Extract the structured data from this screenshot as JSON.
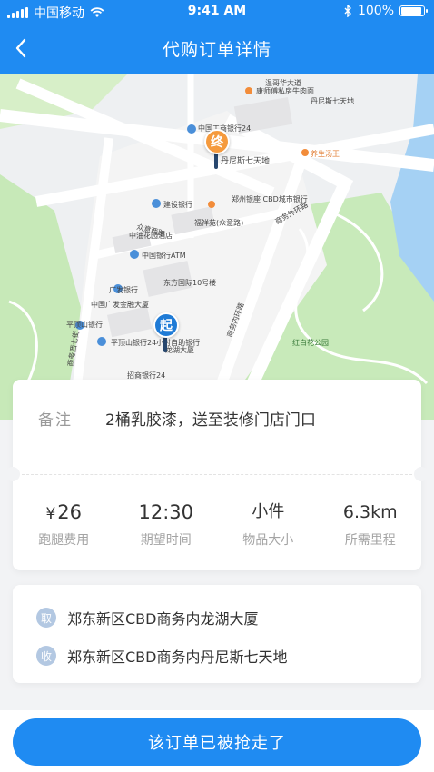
{
  "status_bar": {
    "carrier": "中国移动",
    "time": "9:41 AM",
    "battery": "100%",
    "icons": [
      "signal-icon",
      "wifi-icon",
      "bluetooth-icon",
      "battery-icon"
    ]
  },
  "header": {
    "title": "代购订单详情",
    "back_icon": "chevron-left-icon"
  },
  "map": {
    "start_marker": "起",
    "end_marker": "终",
    "labels": [
      "康师傅私房牛肉面",
      "丹尼斯七天地",
      "中国工商银行24小时自助银行",
      "建设银行",
      "郑州银座\nCBD城市银行",
      "商务外环路",
      "众意西路",
      "中国银行ATM",
      "广发银行",
      "平顶山银行",
      "平顶山银行24小时自助银行",
      "招商银行24",
      "养生汤王",
      "龙湖大厦",
      "红白花公园",
      "东方国际10号楼",
      "中国广发金融大厦",
      "商务内环路",
      "福祥苑(众意路)",
      "中油花园酒店",
      "中国工商银行24",
      "温哥华大道",
      "丹尼斯七天地",
      "商务西七街"
    ]
  },
  "order": {
    "remark_label": "备注",
    "remark_value": "2桶乳胶漆，送至装修门店门口",
    "stats": [
      {
        "currency": "¥",
        "value": "26",
        "caption": "跑腿费用"
      },
      {
        "currency": "",
        "value": "12:30",
        "caption": "期望时间"
      },
      {
        "currency": "",
        "value": "小件",
        "caption": "物品大小"
      },
      {
        "currency": "",
        "value": "6.3km",
        "caption": "所需里程"
      }
    ]
  },
  "addresses": {
    "pickup_badge": "取",
    "pickup": "郑东新区CBD商务内龙湖大厦",
    "deliver_badge": "收",
    "deliver": "郑东新区CBD商务内丹尼斯七天地"
  },
  "action": {
    "button_label": "该订单已被抢走了"
  },
  "colors": {
    "primary": "#1f8bf2",
    "start_pin": "#1f7bd6",
    "end_pin": "#f59a3d",
    "badge": "#b3c8e2"
  }
}
